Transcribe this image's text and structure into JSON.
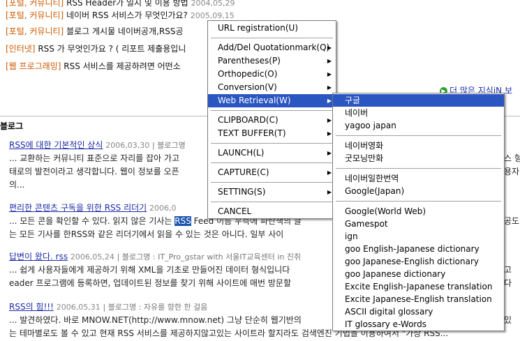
{
  "news": [
    {
      "category": "[포털, 커뮤니티]",
      "title": "RSS Header가 일지 및 이용 방법",
      "date": "2004,05,29"
    },
    {
      "category": "[포털, 커뮤니티]",
      "title": "네이버 RSS 서비스가 무엇인가요?",
      "date": "2005,09,15"
    },
    {
      "category": "[포털, 커뮤니티]",
      "title": "블로그 게시물 네이버공개,RSS공",
      "date": ""
    },
    {
      "category": "[인터넷]",
      "title": "RSS 가 무엇인가요 ? ( 리포트 제출용입니",
      "date": ""
    },
    {
      "category": "[웹 프로그래밍]",
      "title": "RSS 서비스를 제공하려면 어떤소",
      "date": ""
    }
  ],
  "more_link": "더 많은 지식iN 보",
  "blog_section": {
    "heading": "블로그"
  },
  "blogs": [
    {
      "title": "RSS에 대한 기본적인 상식",
      "date": "2006,03,30",
      "meta": "| 블로그명",
      "lines": [
        "... 교환하는 커뮤니티 표준으로 자리를 잡아 가고",
        "태로의 발전이라고 생각합니다. 웹이 정보를 오픈",
        "의..."
      ],
      "right_lines": [
        "스 형",
        "용자"
      ]
    },
    {
      "title": "편리한 콘텐츠 구독을 위한 RSS 리더기",
      "date": "2006,0",
      "meta": "",
      "lines_pre": "... 모든 콘을 확인할 수 있다. 읽지 않은 기사는 ",
      "highlight": "RSS",
      "lines_post": " Feed 이름 우측에 파란색의 글",
      "line2": "는 모든 기사를 한RSS와 같은 리더기에서 읽을 수 있는 것은 아니다. 일부 사이",
      "right_lines": [
        "공도"
      ]
    },
    {
      "title": "답변이 왔다. rss",
      "date": "2006,05,24",
      "meta": "| 블로그명 : IT_Pro_gstar with 서울IT교육센터 in 진취",
      "lines": [
        "... 쉽게 사용자들에게 제공하기 위해 XML을 기초로 만들어진 데이터 형식입니다",
        "eader 프로그램에 등록하면, 업데이트된 정보를 찾기 위해 사이트에 매번 방문할"
      ],
      "right_lines": [
        "고",
        "다"
      ]
    },
    {
      "title": "RSS의 힘!!!",
      "date": "2006,05,31",
      "meta": "| 블로그명 : 자유를 향한 한 걸음",
      "lines": [
        "... 발견하였다. 바로 MNOW.NET(http://www.mnow.net) 그냥 단순히 웹기반의",
        "는 테마별로도 볼 수 있고 현재 RSS 서비스를 제공하지않고있는 사이트라 할지라도 검색엔진 기법을 이용하여서 \"가상 RSS..."
      ],
      "right_lines": [
        "있"
      ]
    }
  ],
  "context_menu": {
    "groups": [
      [
        {
          "label": "URL registration(U)",
          "submenu": false
        }
      ],
      [
        {
          "label": "Add/Del Quotationmark(Q)",
          "submenu": true
        },
        {
          "label": "Parentheses(P)",
          "submenu": true
        },
        {
          "label": "Orthopedic(O)",
          "submenu": true
        },
        {
          "label": "Conversion(V)",
          "submenu": true
        },
        {
          "label": "Web Retrieval(W)",
          "submenu": true,
          "selected": true
        }
      ],
      [
        {
          "label": "CLIPBOARD(C)",
          "submenu": true
        },
        {
          "label": "TEXT BUFFER(T)",
          "submenu": true
        }
      ],
      [
        {
          "label": "LAUNCH(L)",
          "submenu": true
        }
      ],
      [
        {
          "label": "CAPTURE(C)",
          "submenu": true
        }
      ],
      [
        {
          "label": "SETTING(S)",
          "submenu": true
        }
      ],
      [
        {
          "label": "CANCEL",
          "submenu": false
        }
      ]
    ]
  },
  "web_retrieval_menu": {
    "groups": [
      [
        "구글",
        "네이버",
        "yagoo japan"
      ],
      [
        "네이버영화",
        "굿모닝만화"
      ],
      [
        "네이버일한번역",
        "Google(Japan)"
      ],
      [
        "Google(World Web)",
        "Gamespot",
        "ign",
        "goo English-Japanese dictionary",
        "goo Japanese-English dictionary",
        "goo Japanese dictionary",
        "Excite English-Japanese translation",
        "Excite Japanese-English translation",
        "ASCII digital glossary",
        "IT glossary e-Words"
      ]
    ],
    "selected": "구글"
  }
}
